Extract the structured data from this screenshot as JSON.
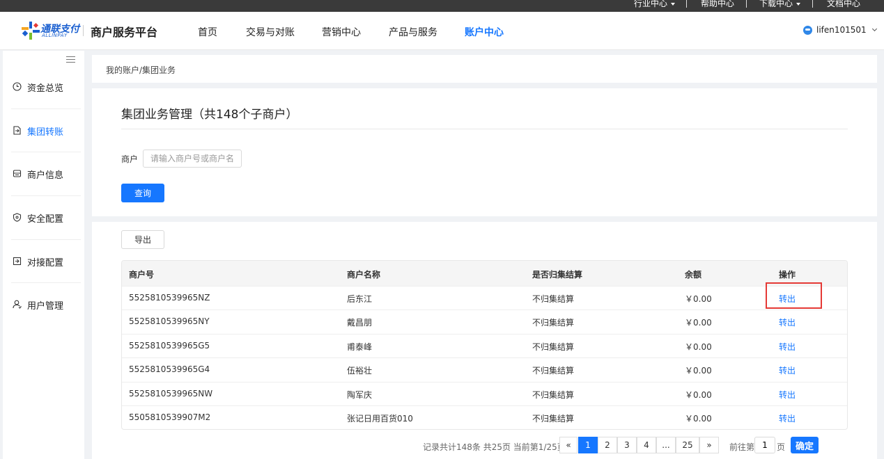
{
  "topbar": {
    "items": [
      {
        "label": "行业中心",
        "dropdown": true
      },
      {
        "label": "帮助中心",
        "dropdown": false
      },
      {
        "label": "下载中心",
        "dropdown": true
      },
      {
        "label": "文档中心",
        "dropdown": false
      }
    ]
  },
  "header": {
    "logo_text": "通联支付",
    "logo_subtext": "ALLINPAY",
    "platform": "商户服务平台",
    "nav": [
      "首页",
      "交易与对账",
      "营销中心",
      "产品与服务",
      "账户中心"
    ],
    "active_nav": "账户中心",
    "username": "lifen101501"
  },
  "sidebar": {
    "items": [
      {
        "label": "资金总览",
        "icon": "clock-icon"
      },
      {
        "label": "集团转账",
        "icon": "document-transfer-icon"
      },
      {
        "label": "商户信息",
        "icon": "store-icon"
      },
      {
        "label": "安全配置",
        "icon": "shield-icon"
      },
      {
        "label": "对接配置",
        "icon": "plug-icon"
      },
      {
        "label": "用户管理",
        "icon": "user-icon"
      }
    ],
    "active_index": 1
  },
  "breadcrumb": "我的账户/集团业务",
  "page": {
    "title": "集团业务管理（共148个子商户）",
    "search_label": "商户",
    "search_placeholder": "请输入商户号或商户名,",
    "query_button": "查询",
    "export_button": "导出"
  },
  "table": {
    "columns": [
      "商户号",
      "商户名称",
      "是否归集结算",
      "余额",
      "操作"
    ],
    "rows": [
      {
        "id": "5525810539965NZ",
        "name": "后东江",
        "settle": "不归集结算",
        "balance": "￥0.00",
        "action": "转出"
      },
      {
        "id": "5525810539965NY",
        "name": "戴昌朋",
        "settle": "不归集结算",
        "balance": "￥0.00",
        "action": "转出"
      },
      {
        "id": "5525810539965G5",
        "name": "甫泰峰",
        "settle": "不归集结算",
        "balance": "￥0.00",
        "action": "转出"
      },
      {
        "id": "5525810539965G4",
        "name": "伍裕壮",
        "settle": "不归集结算",
        "balance": "￥0.00",
        "action": "转出"
      },
      {
        "id": "5525810539965NW",
        "name": "陶军庆",
        "settle": "不归集结算",
        "balance": "￥0.00",
        "action": "转出"
      },
      {
        "id": "5505810539907M2",
        "name": "张记日用百货010",
        "settle": "不归集结算",
        "balance": "￥0.00",
        "action": "转出"
      }
    ]
  },
  "pagination": {
    "info": "记录共计148条 共25页 当前第1/25页",
    "prev": "«",
    "pages": [
      "1",
      "2",
      "3",
      "4",
      "...",
      "25"
    ],
    "next": "»",
    "current": "1",
    "goto_prefix": "前往第",
    "goto_value": "1",
    "goto_suffix": "页",
    "confirm": "确定"
  },
  "colors": {
    "accent": "#1677ff",
    "highlight_box": "#e53935",
    "topbar": "#3a3a3a"
  }
}
